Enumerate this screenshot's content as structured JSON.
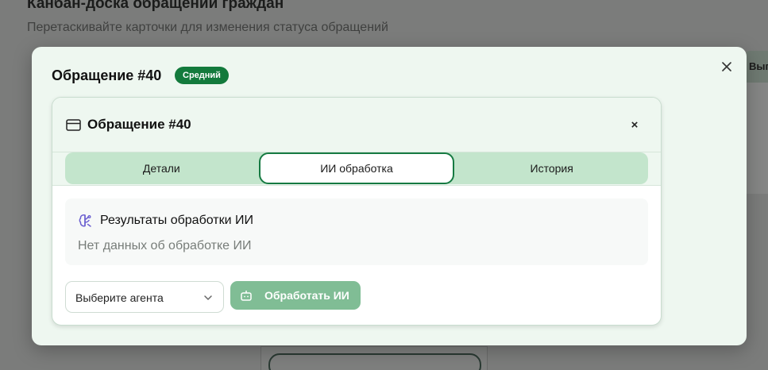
{
  "background": {
    "title": "Канбан-доска обращений граждан",
    "subtitle": "Перетаскивайте карточки для изменения статуса обращений",
    "column_label": "Вып"
  },
  "modal": {
    "title": "Обращение #40",
    "priority_badge": "Средний",
    "close_icon": "close-icon"
  },
  "card": {
    "title": "Обращение #40",
    "icon": "card-icon",
    "close_label": "×"
  },
  "tabs": [
    {
      "label": "Детали",
      "active": false
    },
    {
      "label": "ИИ обработка",
      "active": true
    },
    {
      "label": "История",
      "active": false
    }
  ],
  "results": {
    "icon": "brain-icon",
    "title": "Результаты обработки ИИ",
    "empty_text": "Нет данных об обработке ИИ"
  },
  "agent_select": {
    "value": "Выберите агента",
    "icon": "chevron-down-icon"
  },
  "process_button": {
    "label": "Обработать ИИ",
    "icon": "bot-icon"
  },
  "colors": {
    "accent": "#137a3c",
    "modal_bg": "#eef7f0",
    "tabs_bg": "#c3e5cc",
    "button_disabled": "#80bd95"
  }
}
